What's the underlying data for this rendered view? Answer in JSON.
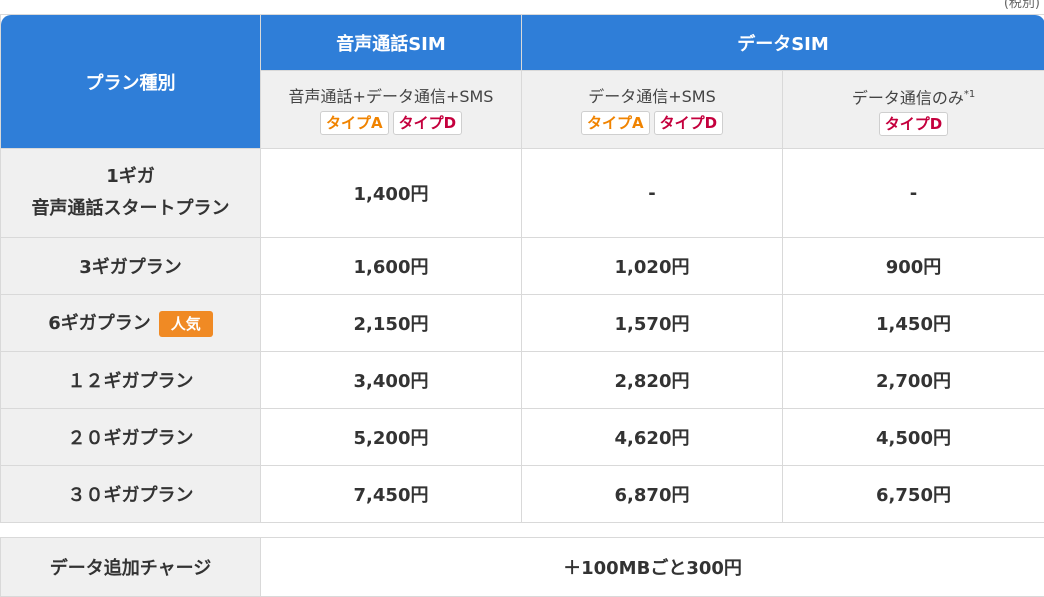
{
  "tax_note": "(税別)",
  "header": {
    "plan_type": "プラン種別",
    "voice_sim": "音声通話SIM",
    "data_sim": "データSIM"
  },
  "sub_headers": [
    {
      "text": "音声通話+データ通信+SMS",
      "badges": [
        "タイプA",
        "タイプD"
      ]
    },
    {
      "text": "データ通信+SMS",
      "badges": [
        "タイプA",
        "タイプD"
      ]
    },
    {
      "text": "データ通信のみ",
      "note": "*1",
      "badges": [
        "タイプD"
      ]
    }
  ],
  "rows": [
    {
      "label_line1": "1ギガ",
      "label_line2": "音声通話スタートプラン",
      "values": [
        "1,400円",
        "-",
        "-"
      ]
    },
    {
      "label": "3ギガプラン",
      "values": [
        "1,600円",
        "1,020円",
        "900円"
      ]
    },
    {
      "label": "6ギガプラン",
      "popular": "人気",
      "values": [
        "2,150円",
        "1,570円",
        "1,450円"
      ]
    },
    {
      "label": "１２ギガプラン",
      "values": [
        "3,400円",
        "2,820円",
        "2,700円"
      ]
    },
    {
      "label": "２０ギガプラン",
      "values": [
        "5,200円",
        "4,620円",
        "4,500円"
      ]
    },
    {
      "label": "３０ギガプラン",
      "values": [
        "7,450円",
        "6,870円",
        "6,750円"
      ]
    }
  ],
  "extra": {
    "label": "データ追加チャージ",
    "value": "＋100MBごと300円"
  },
  "colors": {
    "header_blue": "#2f7ed8",
    "type_a": "#f08300",
    "type_d": "#c4003d",
    "popular": "#f08a24",
    "label_bg": "#f0f0f0"
  }
}
